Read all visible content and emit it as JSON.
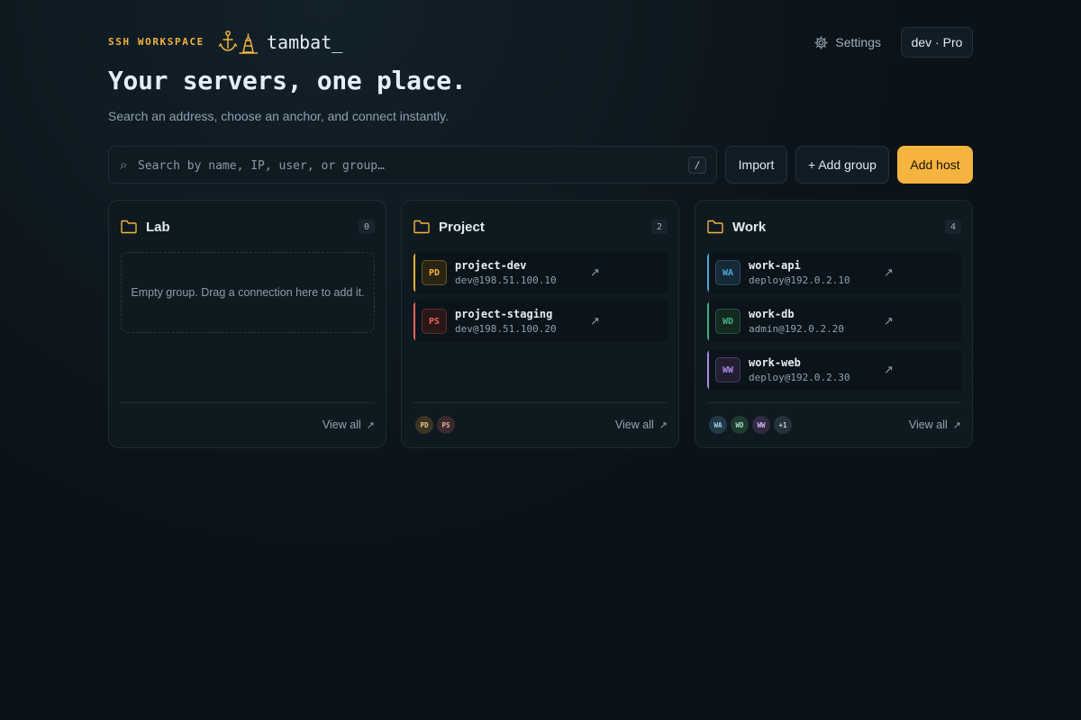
{
  "header": {
    "workspace_tag": "SSH WORKSPACE",
    "logo_text": "tambat_",
    "settings_label": "Settings",
    "user_plan": "dev · Pro"
  },
  "hero": {
    "title": "Your servers, one place.",
    "subtitle": "Search an address, choose an anchor, and connect instantly."
  },
  "toolbar": {
    "search_placeholder": "Search by name, IP, user, or group…",
    "search_icon": "⌕",
    "shortcut_key": "/",
    "import_label": "Import",
    "add_group_label": "+ Add group",
    "add_host_label": "Add host"
  },
  "colors": {
    "accent": "#f4b43f",
    "amber": "#f2b33d",
    "red": "#e8675e",
    "blue": "#4fa6d8",
    "green": "#3fb27f",
    "purple": "#a98be0"
  },
  "groups": [
    {
      "name": "Lab",
      "count": "0",
      "empty_text": "Empty group. Drag a connection here to add it.",
      "view_all": "View all",
      "hosts": [],
      "avatars": []
    },
    {
      "name": "Project",
      "count": "2",
      "view_all": "View all",
      "hosts": [
        {
          "initials": "PD",
          "name": "project-dev",
          "address": "dev@198.51.100.10",
          "color": "amber"
        },
        {
          "initials": "PS",
          "name": "project-staging",
          "address": "dev@198.51.100.20",
          "color": "red"
        }
      ],
      "avatars": [
        "PD",
        "PS"
      ]
    },
    {
      "name": "Work",
      "count": "4",
      "view_all": "View all",
      "hosts": [
        {
          "initials": "WA",
          "name": "work-api",
          "address": "deploy@192.0.2.10",
          "color": "blue"
        },
        {
          "initials": "WD",
          "name": "work-db",
          "address": "admin@192.0.2.20",
          "color": "green"
        },
        {
          "initials": "WW",
          "name": "work-web",
          "address": "deploy@192.0.2.30",
          "color": "purple"
        }
      ],
      "avatars": [
        "WA",
        "WD",
        "WW",
        "+1"
      ]
    }
  ]
}
